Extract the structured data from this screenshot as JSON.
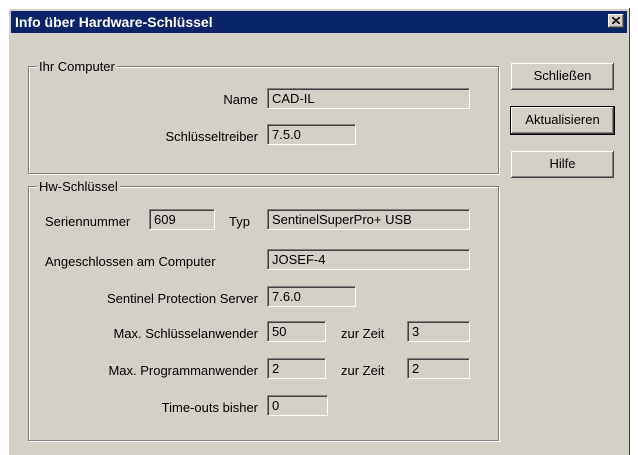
{
  "window": {
    "title": "Info über Hardware-Schlüssel"
  },
  "computer_group": {
    "legend": "Ihr Computer",
    "name_label": "Name",
    "name_value": "CAD-IL",
    "driver_label": "Schlüsseltreiber",
    "driver_value": "7.5.0"
  },
  "key_group": {
    "legend": "Hw-Schlüssel",
    "serial_label": "Seriennummer",
    "serial_value": "609",
    "type_label": "Typ",
    "type_value": "SentinelSuperPro+ USB",
    "connected_label": "Angeschlossen am Computer",
    "connected_value": "JOSEF-4",
    "server_label": "Sentinel Protection Server",
    "server_value": "7.6.0",
    "max_key_users_label": "Max. Schlüsselanwender",
    "max_key_users_value": "50",
    "key_users_now_label": "zur Zeit",
    "key_users_now_value": "3",
    "max_program_users_label": "Max. Programmanwender",
    "max_program_users_value": "2",
    "program_users_now_label": "zur Zeit",
    "program_users_now_value": "2",
    "timeouts_label": "Time-outs bisher",
    "timeouts_value": "0"
  },
  "buttons": {
    "close": "Schließen",
    "refresh": "Aktualisieren",
    "help": "Hilfe"
  }
}
